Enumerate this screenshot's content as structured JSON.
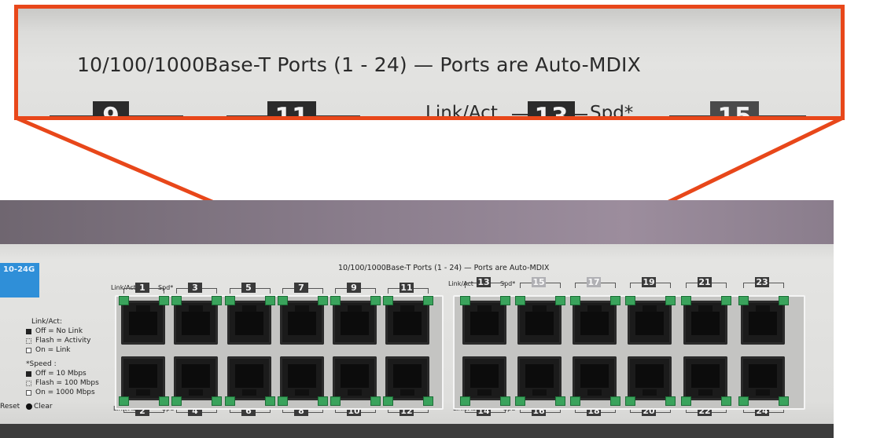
{
  "zoom": {
    "title": "10/100/1000Base-T Ports (1 - 24) — Ports are Auto-MDIX",
    "link_act": "Link/Act",
    "spd": "Spd*",
    "ports": [
      "9",
      "11",
      "13",
      "15"
    ]
  },
  "photo": {
    "model": "10-24G",
    "title": "10/100/1000Base-T Ports (1 - 24) — Ports are Auto-MDIX",
    "legend": {
      "link_act_heading": "Link/Act:",
      "off_no_link": "Off = No Link",
      "flash_activity": "Flash = Activity",
      "on_link": "On = Link",
      "speed_heading": "*Speed :",
      "off_10": "Off = 10 Mbps",
      "flash_100": "Flash = 100 Mbps",
      "on_1000": "On = 1000 Mbps"
    },
    "reset": "Reset",
    "clear": "Clear",
    "link_act": "Link/Act",
    "spd": "Spd*",
    "top_ports": [
      "1",
      "3",
      "5",
      "7",
      "9",
      "11",
      "13",
      "15",
      "17",
      "19",
      "21",
      "23"
    ],
    "bottom_ports": [
      "2",
      "4",
      "6",
      "8",
      "10",
      "12",
      "14",
      "16",
      "18",
      "20",
      "22",
      "24"
    ]
  },
  "colors": {
    "callout": "#e8471a",
    "led_green": "#3aa35c",
    "badge_blue": "#2f8fd8"
  }
}
